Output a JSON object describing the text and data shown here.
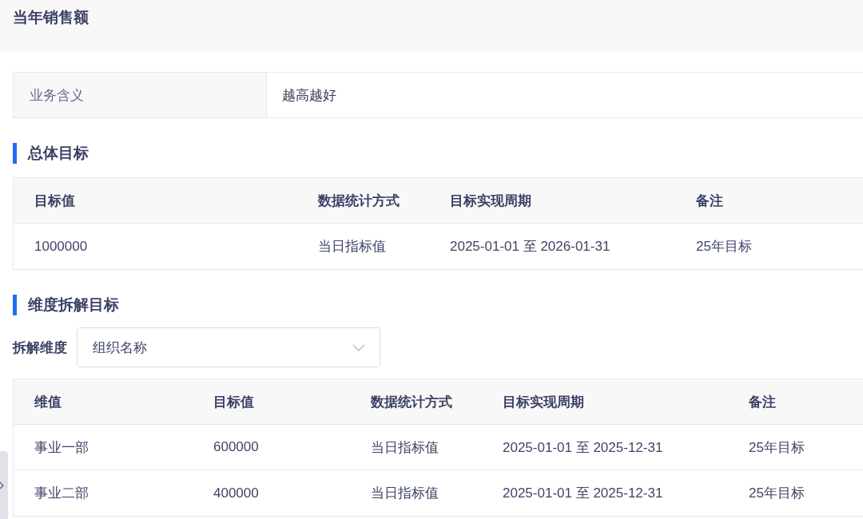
{
  "header": {
    "title": "当年销售额"
  },
  "info": {
    "label": "业务含义",
    "value": "越高越好"
  },
  "overall": {
    "title": "总体目标",
    "table": {
      "columns": [
        "目标值",
        "数据统计方式",
        "目标实现周期",
        "备注"
      ],
      "rows": [
        [
          "1000000",
          "当日指标值",
          "2025-01-01 至 2026-01-31",
          "25年目标"
        ]
      ]
    }
  },
  "breakdown": {
    "title": "维度拆解目标",
    "filter": {
      "label": "拆解维度",
      "value": "组织名称"
    },
    "table": {
      "columns": [
        "维值",
        "目标值",
        "数据统计方式",
        "目标实现周期",
        "备注"
      ],
      "rows": [
        [
          "事业一部",
          "600000",
          "当日指标值",
          "2025-01-01 至 2025-12-31",
          "25年目标"
        ],
        [
          "事业二部",
          "400000",
          "当日指标值",
          "2025-01-01 至 2025-12-31",
          "25年目标"
        ]
      ]
    }
  }
}
